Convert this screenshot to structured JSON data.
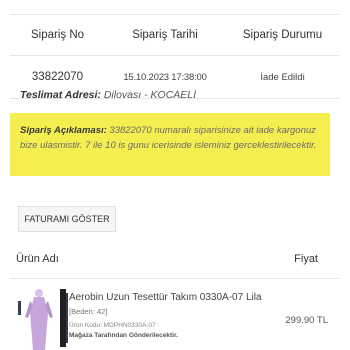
{
  "order_table": {
    "headers": {
      "order_no": "Sipariş No",
      "order_date": "Sipariş Tarihi",
      "order_status": "Sipariş Durumu"
    },
    "values": {
      "order_no": "33822070",
      "order_date": "15.10.2023 17:38:00",
      "order_status": "İade Edildi"
    }
  },
  "delivery": {
    "label": "Teslimat Adresi:",
    "value": "Dilovası - KOCAELİ"
  },
  "notice": {
    "label": "Sipariş Açıklaması:",
    "text": "33822070 numaralı siparisinize ait iade kargonuz bize ulasmistir. 7 ile 10 is gunu icerisinde isleminiz gerceklestirilecektir.",
    "background_color": "#f4ee50"
  },
  "invoice_button": {
    "label": "FATURAMI GÖSTER"
  },
  "products_header": {
    "name_col": "Ürün Adı",
    "price_col": "Fiyat"
  },
  "products": [
    {
      "name": "Aerobin Uzun Tesettür Takım 0330A-07 Lila",
      "size": "[Beden: 42]",
      "code": "Ürün Kodu: MDPHN0330A-07",
      "seller": "Mağaza Tarafından Gönderilecektir.",
      "price": "299.90 TL",
      "image_icon": "product-photo-icon",
      "dress_color": "#c7a6dc"
    }
  ]
}
